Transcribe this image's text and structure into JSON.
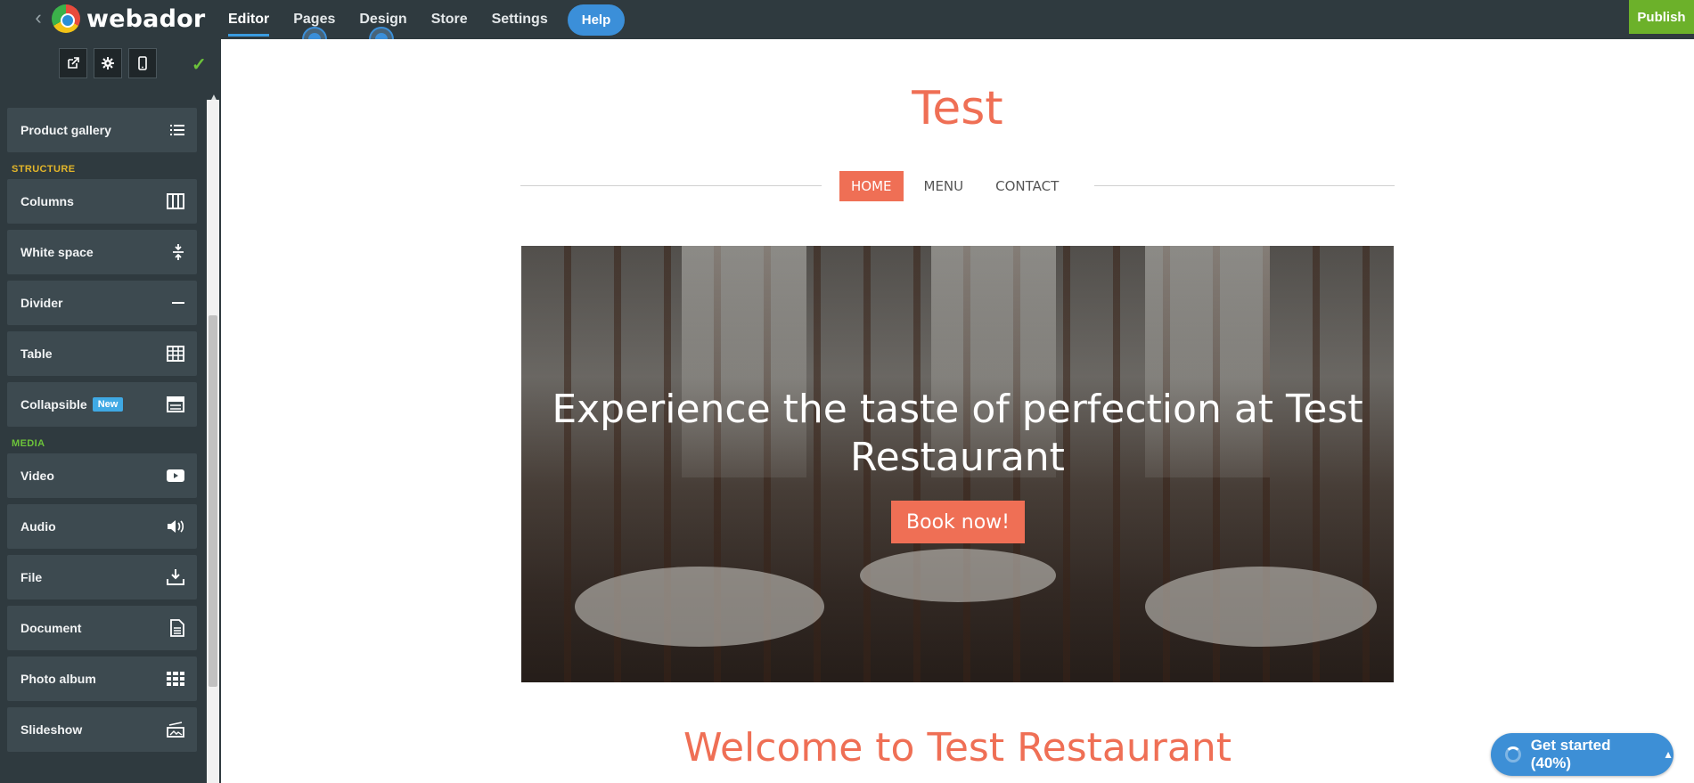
{
  "topbar": {
    "logo_text": "webador",
    "nav": [
      "Editor",
      "Pages",
      "Design",
      "Store",
      "Settings"
    ],
    "help_label": "Help",
    "publish_label": "Publish"
  },
  "sidebar": {
    "top_item": "Product gallery",
    "structure_heading": "STRUCTURE",
    "structure_items": [
      {
        "label": "Columns",
        "icon": "columns-icon"
      },
      {
        "label": "White space",
        "icon": "white-space-icon"
      },
      {
        "label": "Divider",
        "icon": "divider-icon"
      },
      {
        "label": "Table",
        "icon": "table-icon"
      },
      {
        "label": "Collapsible",
        "icon": "collapsible-icon",
        "badge": "New"
      }
    ],
    "media_heading": "MEDIA",
    "media_items": [
      {
        "label": "Video",
        "icon": "video-icon"
      },
      {
        "label": "Audio",
        "icon": "audio-icon"
      },
      {
        "label": "File",
        "icon": "file-download-icon"
      },
      {
        "label": "Document",
        "icon": "document-icon"
      },
      {
        "label": "Photo album",
        "icon": "photo-album-icon"
      },
      {
        "label": "Slideshow",
        "icon": "slideshow-icon"
      }
    ]
  },
  "site": {
    "title": "Test",
    "nav": [
      "HOME",
      "MENU",
      "CONTACT"
    ],
    "hero_heading": "Experience the taste of perfection at Test Restaurant",
    "hero_button": "Book now!",
    "welcome_heading": "Welcome to Test Restaurant"
  },
  "get_started": {
    "label": "Get started (40%)",
    "progress_percent": 40
  },
  "colors": {
    "accent": "#ef6f55",
    "topbar": "#2f3a3f",
    "publish": "#6cb12a",
    "help": "#3b8fd9",
    "structure_heading": "#e2b52a",
    "media_heading": "#6cc33a"
  }
}
